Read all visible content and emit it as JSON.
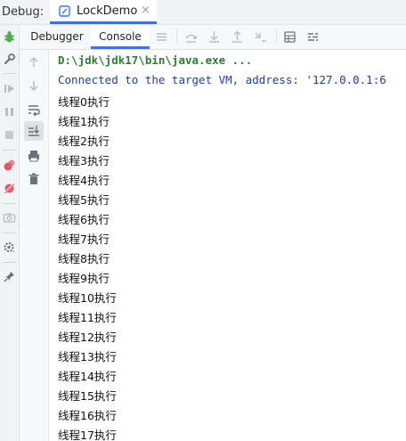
{
  "window": {
    "debug_label": "Debug:",
    "run_tab": {
      "label": "LockDemo",
      "close": "×"
    }
  },
  "toolbar": {
    "tabs": [
      {
        "label": "Debugger"
      },
      {
        "label": "Console"
      }
    ],
    "icons": [
      "menu-icon",
      "step-over-icon",
      "step-into-icon",
      "step-out-icon",
      "run-to-cursor-icon",
      "evaluate-icon",
      "trace-icon"
    ]
  },
  "gutter_icons": [
    "bug-icon",
    "wrench-icon",
    "resume-icon",
    "pause-icon",
    "stop-icon",
    "breakpoints-icon",
    "mute-breakpoints-icon",
    "camera-icon",
    "settings-icon",
    "pin-icon"
  ],
  "console_toolbar_icons": [
    "up-arrow-icon",
    "down-arrow-icon",
    "soft-wrap-icon",
    "scroll-to-end-icon",
    "print-icon",
    "trash-icon"
  ],
  "console": {
    "command": "D:\\jdk\\jdk17\\bin\\java.exe ...",
    "connected": "Connected to the target VM, address: '127.0.0.1:6",
    "lines": [
      "线程0执行",
      "线程1执行",
      "线程2执行",
      "线程3执行",
      "线程4执行",
      "线程5执行",
      "线程6执行",
      "线程7执行",
      "线程8执行",
      "线程9执行",
      "线程10执行",
      "线程11执行",
      "线程12执行",
      "线程13执行",
      "线程14执行",
      "线程15执行",
      "线程16执行",
      "线程17执行"
    ]
  },
  "colors": {
    "accent": "#3574f0",
    "command_text": "#2e7d32",
    "info_text": "#1f3fa0"
  }
}
